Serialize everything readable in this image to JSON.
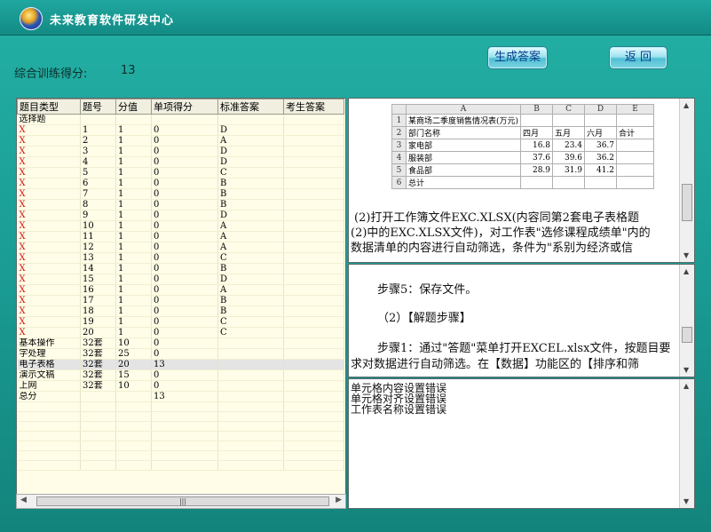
{
  "app": {
    "title": "未来教育软件研发中心"
  },
  "score": {
    "label": "综合训练得分:",
    "value": "13"
  },
  "buttons": {
    "generate": "生成答案",
    "back": "返 回"
  },
  "grid": {
    "headers": [
      "题目类型",
      "题号",
      "分值",
      "单项得分",
      "标准答案",
      "考生答案"
    ],
    "section_choice": "选择题",
    "choice_rows": [
      {
        "mark": "X",
        "no": "1",
        "score": "1",
        "got": "0",
        "ans": "D"
      },
      {
        "mark": "X",
        "no": "2",
        "score": "1",
        "got": "0",
        "ans": "A"
      },
      {
        "mark": "X",
        "no": "3",
        "score": "1",
        "got": "0",
        "ans": "D"
      },
      {
        "mark": "X",
        "no": "4",
        "score": "1",
        "got": "0",
        "ans": "D"
      },
      {
        "mark": "X",
        "no": "5",
        "score": "1",
        "got": "0",
        "ans": "C"
      },
      {
        "mark": "X",
        "no": "6",
        "score": "1",
        "got": "0",
        "ans": "B"
      },
      {
        "mark": "X",
        "no": "7",
        "score": "1",
        "got": "0",
        "ans": "B"
      },
      {
        "mark": "X",
        "no": "8",
        "score": "1",
        "got": "0",
        "ans": "B"
      },
      {
        "mark": "X",
        "no": "9",
        "score": "1",
        "got": "0",
        "ans": "D"
      },
      {
        "mark": "X",
        "no": "10",
        "score": "1",
        "got": "0",
        "ans": "A"
      },
      {
        "mark": "X",
        "no": "11",
        "score": "1",
        "got": "0",
        "ans": "A"
      },
      {
        "mark": "X",
        "no": "12",
        "score": "1",
        "got": "0",
        "ans": "A"
      },
      {
        "mark": "X",
        "no": "13",
        "score": "1",
        "got": "0",
        "ans": "C"
      },
      {
        "mark": "X",
        "no": "14",
        "score": "1",
        "got": "0",
        "ans": "B"
      },
      {
        "mark": "X",
        "no": "15",
        "score": "1",
        "got": "0",
        "ans": "D"
      },
      {
        "mark": "X",
        "no": "16",
        "score": "1",
        "got": "0",
        "ans": "A"
      },
      {
        "mark": "X",
        "no": "17",
        "score": "1",
        "got": "0",
        "ans": "B"
      },
      {
        "mark": "X",
        "no": "18",
        "score": "1",
        "got": "0",
        "ans": "B"
      },
      {
        "mark": "X",
        "no": "19",
        "score": "1",
        "got": "0",
        "ans": "C"
      },
      {
        "mark": "X",
        "no": "20",
        "score": "1",
        "got": "0",
        "ans": "C"
      }
    ],
    "category_rows": [
      {
        "type": "基本操作",
        "no": "32套",
        "score": "10",
        "got": "0",
        "hl": false
      },
      {
        "type": "字处理",
        "no": "32套",
        "score": "25",
        "got": "0",
        "hl": false
      },
      {
        "type": "电子表格",
        "no": "32套",
        "score": "20",
        "got": "13",
        "hl": true
      },
      {
        "type": "演示文稿",
        "no": "32套",
        "score": "15",
        "got": "0",
        "hl": false
      },
      {
        "type": "上网",
        "no": "32套",
        "score": "10",
        "got": "0",
        "hl": false
      }
    ],
    "total_label": "总分",
    "total_value": "13"
  },
  "excel_preview": {
    "col_headers": [
      "",
      "A",
      "B",
      "C",
      "D",
      "E"
    ],
    "rows": [
      {
        "n": "1",
        "cells": [
          "某商场二季度销售情况表(万元)",
          "",
          "",
          "",
          ""
        ]
      },
      {
        "n": "2",
        "cells": [
          "部门名称",
          "四月",
          "五月",
          "六月",
          "合计"
        ]
      },
      {
        "n": "3",
        "cells": [
          "家电部",
          "16.8",
          "23.4",
          "36.7",
          ""
        ]
      },
      {
        "n": "4",
        "cells": [
          "服装部",
          "37.6",
          "39.6",
          "36.2",
          ""
        ]
      },
      {
        "n": "5",
        "cells": [
          "食品部",
          "28.9",
          "31.9",
          "41.2",
          ""
        ]
      },
      {
        "n": "6",
        "cells": [
          "总计",
          "",
          "",
          "",
          ""
        ]
      }
    ]
  },
  "question_text": {
    "line1": "    (2)打开工作簿文件EXC.XLSX(内容同第2套电子表格题",
    "line2": "(2)中的EXC.XLSX文件)，对工作表\"选修课程成绩单\"内的",
    "line3": "数据清单的内容进行自动筛选，条件为\"系别为经济或信"
  },
  "solution_text": {
    "line1": "步骤5：保存文件。",
    "line2": "（2）【解题步骤】",
    "line3": "步骤1：通过\"答题\"菜单打开EXCEL.xlsx文件，按题目要",
    "line4": "求对数据进行自动筛选。在【数据】功能区的【排序和筛"
  },
  "errors": [
    "单元格内容设置错误",
    "单元格对齐设置错误",
    "工作表名称设置错误"
  ]
}
